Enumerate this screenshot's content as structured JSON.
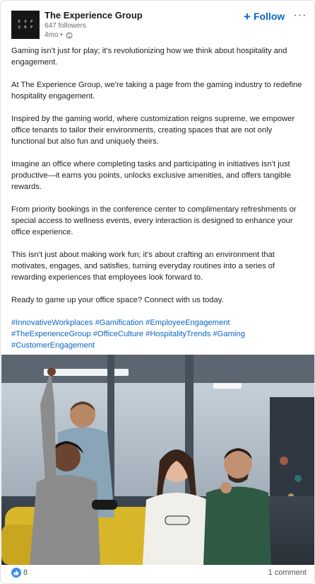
{
  "author": {
    "name": "The Experience Group",
    "followers": "647 followers",
    "age": "4mo •",
    "logo_letters": [
      "E",
      "X",
      "P",
      "G",
      "R",
      "P"
    ]
  },
  "actions": {
    "follow_label": "Follow",
    "more_label": "···"
  },
  "post": {
    "paragraphs": [
      "Gaming isn’t just for play; it’s revolutionizing how we think about hospitality and engagement.",
      "At The Experience Group, we’re taking a page from the gaming industry to redefine hospitality engagement.",
      "Inspired by the gaming world, where customization reigns supreme, we empower office tenants to tailor their environments, creating spaces that are not only functional but also fun and uniquely theirs.",
      "Imagine an office where completing tasks and participating in initiatives isn’t just productive—it earns you points, unlocks exclusive amenities, and offers tangible rewards.",
      "From priority bookings in the conference center to complimentary refreshments or special access to wellness events, every interaction is designed to enhance your office experience.",
      "This isn’t just about making work fun; it’s about crafting an environment that motivates, engages, and satisfies, turning everyday routines into a series of rewarding experiences that employees look forward to.",
      "Ready to game up your office space? Connect with us today."
    ],
    "hashtags": [
      "#InnovativeWorkplaces",
      "#Gamification",
      "#EmployeeEngagement",
      "#TheExperienceGroup",
      "#OfficeCulture",
      "#HospitalityTrends",
      "#Gaming",
      "#CustomerEngagement"
    ]
  },
  "footer": {
    "reaction_count": "8",
    "comments": "1 comment"
  },
  "colors": {
    "link": "#0a66c2",
    "logo_bg": "#161616"
  }
}
